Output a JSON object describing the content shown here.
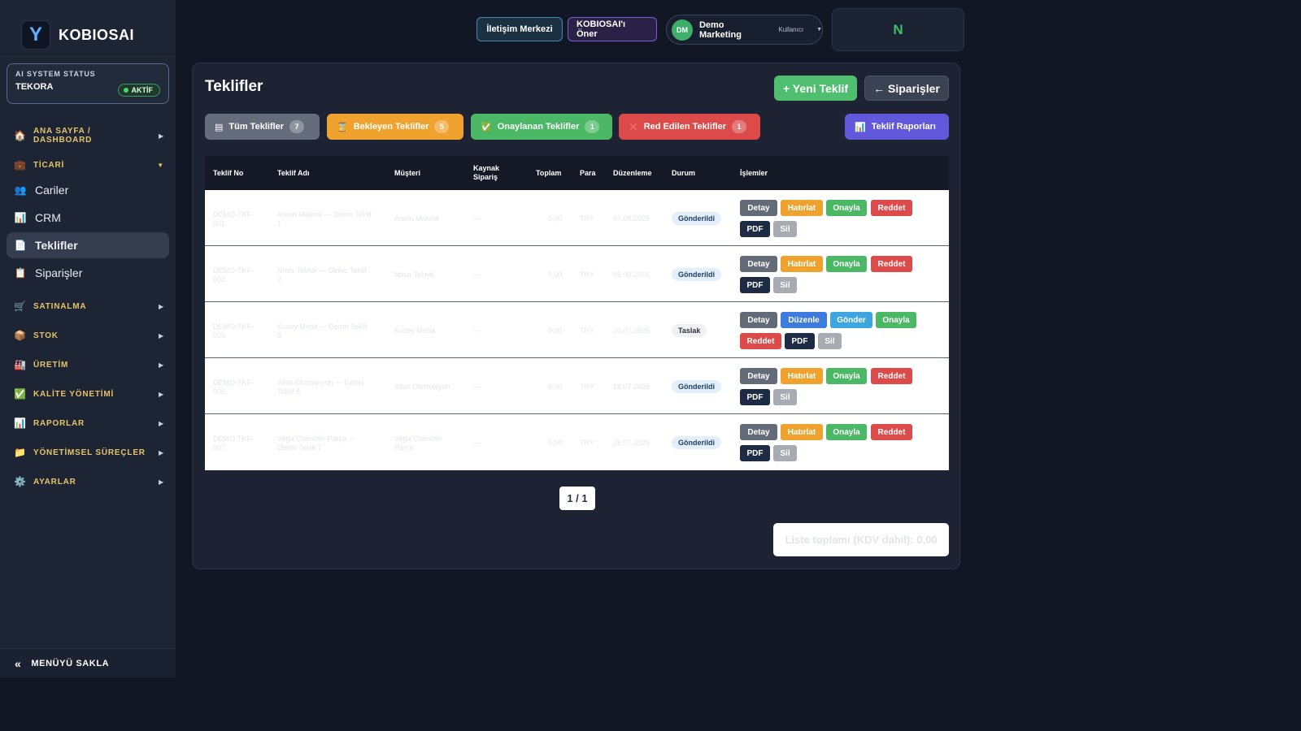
{
  "brand": {
    "logo_letter": "Y",
    "name": "KOBIOSAI"
  },
  "status": {
    "label": "AI SYSTEM STATUS",
    "name": "TEKORA",
    "badge": "AKTİF"
  },
  "nav": {
    "dashboard": "ANA SAYFA / DASHBOARD",
    "ticari": "TİCARİ",
    "cariler": "Cariler",
    "crm": "CRM",
    "teklifler": "Teklifler",
    "siparisler": "Siparişler",
    "satinalma": "SATINALMA",
    "stok": "STOK",
    "uretim": "ÜRETİM",
    "kalite": "KALİTE YÖNETİMİ",
    "raporlar": "RAPORLAR",
    "yonetimsel": "YÖNETİMSEL SÜREÇLER",
    "ayarlar": "AYARLAR",
    "hide_menu": "MENÜYÜ SAKLA"
  },
  "topbar": {
    "contact": "İletişim Merkezi",
    "suggest": "KOBIOSAI'ı Öner",
    "user_initials": "DM",
    "user_name": "Demo Marketing",
    "user_role": "Kullanıcı",
    "n_label": "N"
  },
  "page": {
    "title": "Teklifler",
    "new_button": "+ Yeni Teklif",
    "orders_button": "← Siparişler"
  },
  "filters": {
    "all": {
      "label": "Tüm Teklifler",
      "count": "7"
    },
    "pending": {
      "label": "Bekleyen Teklifler",
      "count": "5"
    },
    "approved": {
      "label": "Onaylanan Teklifler",
      "count": "1"
    },
    "rejected": {
      "label": "Red Edilen Teklifler",
      "count": "1"
    },
    "reports": "Teklif Raporları"
  },
  "table": {
    "headers": {
      "no": "Teklif No",
      "name": "Teklif Adı",
      "customer": "Müşteri",
      "source_1": "Kaynak",
      "source_2": "Sipariş",
      "total": "Toplam",
      "currency": "Para",
      "date": "Düzenleme",
      "status": "Durum",
      "actions": "İşlemler"
    },
    "rows": [
      {
        "no_1": "DEMO-TKF-",
        "no_2": "001",
        "name_1": "Arven Makina — Demo Teklif",
        "name_2": "1",
        "customer_1": "Arven Makina",
        "customer_2": "",
        "source": "—",
        "total": "0,00",
        "currency": "TRY",
        "date": "07.08.2026",
        "status": "Gönderildi"
      },
      {
        "no_1": "DEMO-TKF-",
        "no_2": "002",
        "name_1": "Nova Teknik — Demo Teklif",
        "name_2": "2",
        "customer_1": "Nova Teknik",
        "customer_2": "",
        "source": "—",
        "total": "0,00",
        "currency": "TRY",
        "date": "05.08.2026",
        "status": "Gönderildi"
      },
      {
        "no_1": "DEMO-TKF-",
        "no_2": "005",
        "name_1": "Kuzey Metal — Demo Teklif",
        "name_2": "5",
        "customer_1": "Kuzey Metal",
        "customer_2": "",
        "source": "—",
        "total": "0,00",
        "currency": "TRY",
        "date": "30.07.2026",
        "status": "Taslak"
      },
      {
        "no_1": "DEMO-TKF-",
        "no_2": "006",
        "name_1": "Atlas Otomasyon — Demo",
        "name_2": "Teklif 6",
        "customer_1": "Atlas Otomasyon",
        "customer_2": "",
        "source": "—",
        "total": "0,00",
        "currency": "TRY",
        "date": "28.07.2026",
        "status": "Gönderildi"
      },
      {
        "no_1": "DEMO-TKF-",
        "no_2": "007",
        "name_1": "Vega Otomotiv Parça —",
        "name_2": "Demo Teklif 7",
        "customer_1": "Vega Otomotiv",
        "customer_2": "Parça",
        "source": "—",
        "total": "0,00",
        "currency": "TRY",
        "date": "26.07.2026",
        "status": "Gönderildi"
      }
    ]
  },
  "actions": {
    "detail": "Detay",
    "remind": "Hatırlat",
    "approve": "Onayla",
    "reject": "Reddet",
    "pdf": "PDF",
    "delete": "Sil",
    "edit": "Düzenle",
    "send": "Gönder"
  },
  "pager": "1 / 1",
  "list_total": "Liste toplamı (KDV dahil): 0,00",
  "colors": {
    "background": "#121726",
    "sidebar": "#1d2433",
    "accent_green": "#4fbf6f",
    "accent_orange": "#f0a22f",
    "accent_red": "#dc4a4a",
    "accent_purple": "#6158dc",
    "nav_section": "#e7c469"
  }
}
